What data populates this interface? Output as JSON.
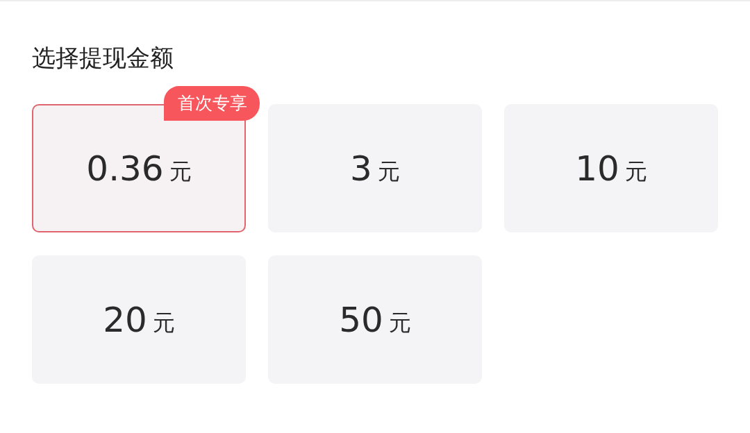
{
  "title": "选择提现金额",
  "options": [
    {
      "amount": "0.36",
      "unit": "元",
      "selected": true,
      "badge": "首次专享"
    },
    {
      "amount": "3",
      "unit": "元",
      "selected": false
    },
    {
      "amount": "10",
      "unit": "元",
      "selected": false
    },
    {
      "amount": "20",
      "unit": "元",
      "selected": false
    },
    {
      "amount": "50",
      "unit": "元",
      "selected": false
    }
  ]
}
